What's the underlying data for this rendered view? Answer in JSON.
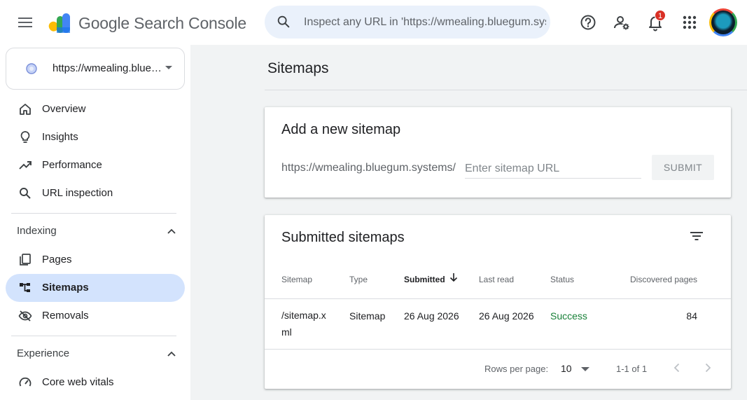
{
  "app": {
    "brand_prefix": "Google",
    "brand_name": "Search Console"
  },
  "search": {
    "placeholder": "Inspect any URL in 'https://wmealing.bluegum.systems/'"
  },
  "toolbar": {
    "notification_count": "1",
    "icons": [
      "help-icon",
      "manage-users-icon",
      "notifications-icon",
      "apps-grid-icon",
      "account-avatar"
    ]
  },
  "property": {
    "name": "https://wmealing.bluegum.systems/"
  },
  "sidebar": {
    "top_items": [
      {
        "label": "Overview",
        "icon": "home-icon"
      },
      {
        "label": "Insights",
        "icon": "lightbulb-icon"
      },
      {
        "label": "Performance",
        "icon": "trending-up-icon"
      },
      {
        "label": "URL inspection",
        "icon": "search-icon"
      }
    ],
    "indexing": {
      "label": "Indexing",
      "items": [
        {
          "label": "Pages",
          "icon": "pages-icon"
        },
        {
          "label": "Sitemaps",
          "icon": "sitemap-icon",
          "active": true
        },
        {
          "label": "Removals",
          "icon": "visibility-off-icon"
        }
      ]
    },
    "experience": {
      "label": "Experience",
      "items": [
        {
          "label": "Core web vitals",
          "icon": "speed-icon"
        }
      ]
    }
  },
  "main": {
    "page_title": "Sitemaps",
    "add_card": {
      "title": "Add a new sitemap",
      "prefix": "https://wmealing.bluegum.systems/",
      "input_placeholder": "Enter sitemap URL",
      "submit_label": "SUBMIT"
    },
    "submitted_card": {
      "title": "Submitted sitemaps",
      "columns": [
        "Sitemap",
        "Type",
        "Submitted",
        "Last read",
        "Status",
        "Discovered pages"
      ],
      "sorted_column": "Submitted",
      "rows": [
        {
          "sitemap": "/sitemap.xml",
          "type": "Sitemap",
          "submitted": "26 Aug 2026",
          "last_read": "26 Aug 2026",
          "status": "Success",
          "discovered_pages": "84"
        }
      ],
      "pagination": {
        "rows_per_page_label": "Rows per page:",
        "rows_per_page": "10",
        "range": "1-1 of 1"
      }
    }
  },
  "colors": {
    "active_nav_bg": "#d3e3fd",
    "search_bg": "#eaf1fb",
    "status_success": "#188038",
    "badge": "#d93025"
  }
}
